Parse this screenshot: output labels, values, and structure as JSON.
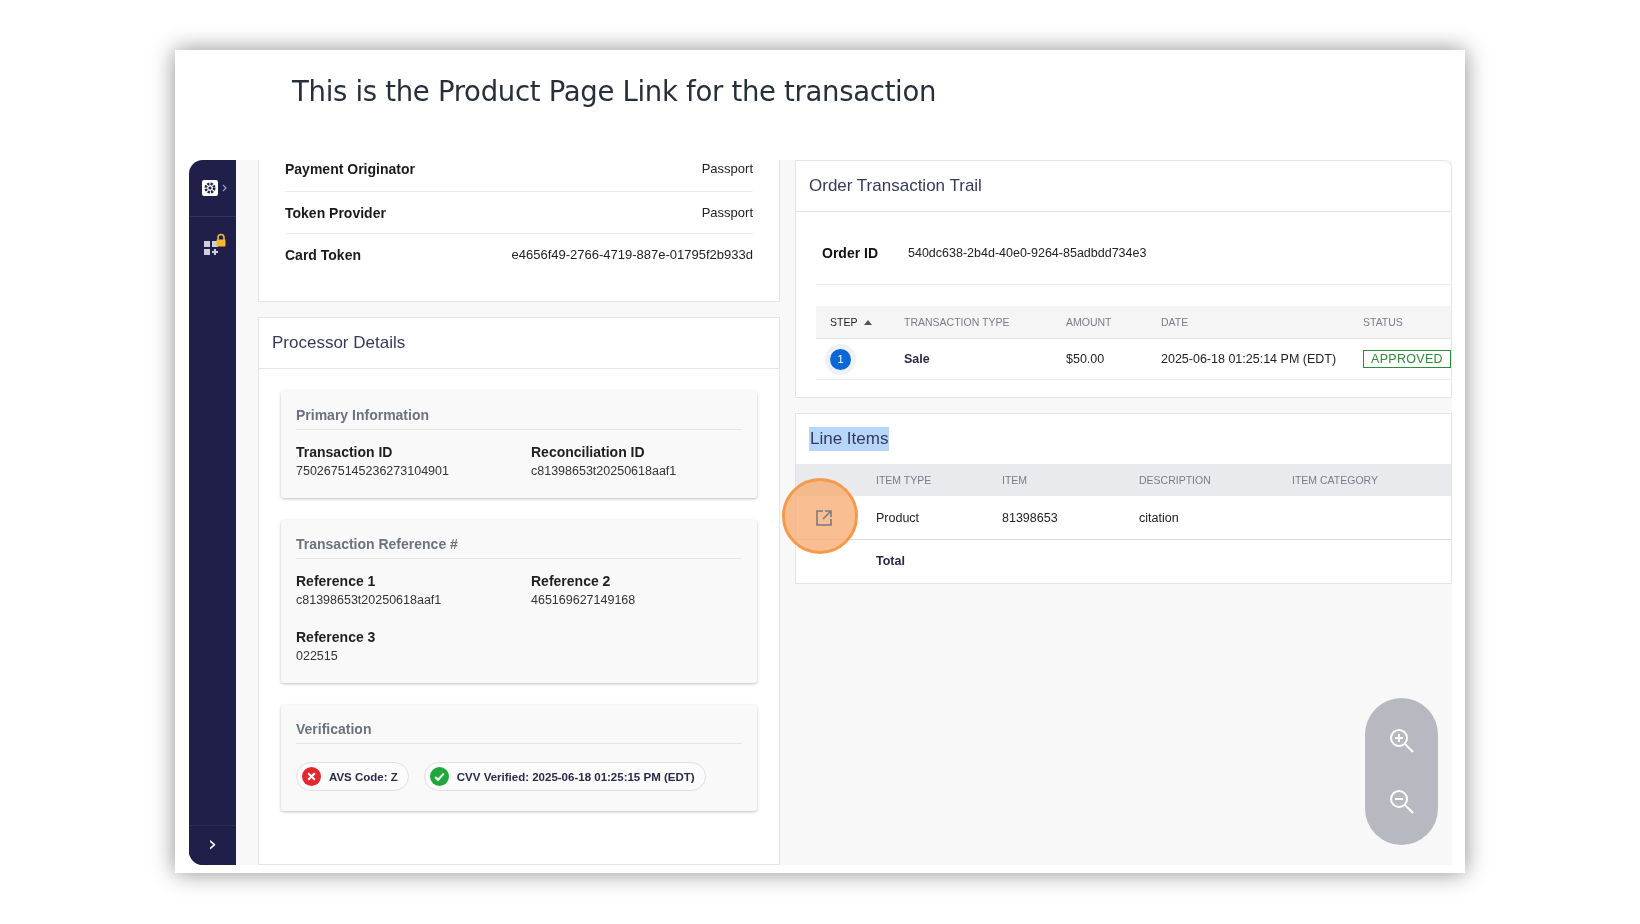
{
  "caption": "This is the Product Page Link for the transaction",
  "sidebar": {
    "items": [
      {
        "kind": "settings"
      },
      {
        "kind": "apps-locked"
      }
    ],
    "expand_label": "›"
  },
  "token_details": {
    "rows": [
      {
        "label": "Payment Originator",
        "value": "Passport"
      },
      {
        "label": "Token Provider",
        "value": "Passport"
      },
      {
        "label": "Card Token",
        "value": "e4656f49-2766-4719-887e-01795f2b933d"
      }
    ]
  },
  "processor_details": {
    "title": "Processor Details",
    "sections": [
      {
        "title": "Primary Information",
        "fields": [
          {
            "label": "Transaction ID",
            "value": "7502675145236273104901"
          },
          {
            "label": "Reconciliation ID",
            "value": "c81398653t20250618aaf1"
          }
        ]
      },
      {
        "title": "Transaction Reference #",
        "fields": [
          {
            "label": "Reference 1",
            "value": "c81398653t20250618aaf1"
          },
          {
            "label": "Reference 2",
            "value": "465169627149168"
          },
          {
            "label": "Reference 3",
            "value": "022515"
          }
        ]
      },
      {
        "title": "Verification",
        "chips": [
          {
            "kind": "fail",
            "label": "AVS Code: Z"
          },
          {
            "kind": "pass",
            "label": "CVV Verified: 2025-06-18 01:25:15 PM (EDT)"
          }
        ]
      }
    ]
  },
  "order_trail": {
    "title": "Order Transaction Trail",
    "order_id_label": "Order ID",
    "order_id": "540dc638-2b4d-40e0-9264-85adbdd734e3",
    "columns": [
      {
        "label": "STEP",
        "sorted": true
      },
      {
        "label": "TRANSACTION TYPE",
        "sorted": false
      },
      {
        "label": "AMOUNT",
        "sorted": false
      },
      {
        "label": "DATE",
        "sorted": false
      },
      {
        "label": "STATUS",
        "sorted": false
      }
    ],
    "rows": [
      {
        "step": "1",
        "type": "Sale",
        "amount": "$50.00",
        "date": "2025-06-18 01:25:14 PM (EDT)",
        "status": "APPROVED",
        "color": "#2e8b3a"
      }
    ]
  },
  "line_items": {
    "title": "Line Items",
    "title_highlighted": true,
    "columns": [
      "ITEM TYPE",
      "ITEM",
      "DESCRIPTION",
      "ITEM CATEGORY"
    ],
    "rows": [
      {
        "item_type": "Product",
        "item": "81398653",
        "description": "citation",
        "highlighted": true
      }
    ],
    "total_label": "Total"
  }
}
